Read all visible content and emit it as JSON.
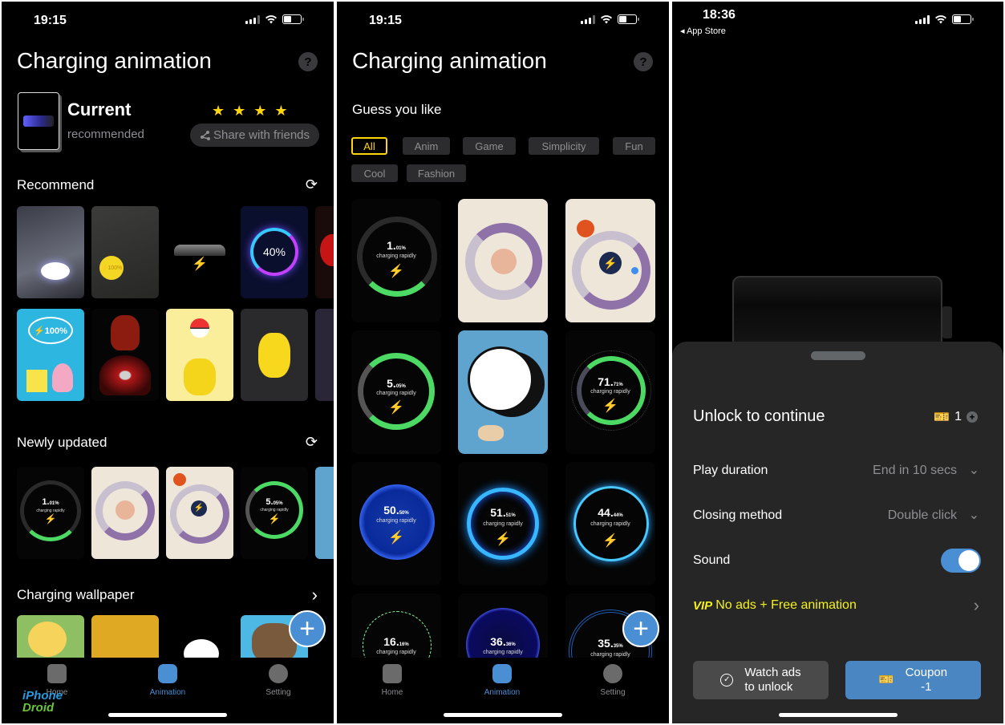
{
  "screens": [
    {
      "status": {
        "time": "19:15"
      },
      "title": "Charging animation",
      "help_glyph": "?",
      "current": {
        "name": "Current",
        "subtitle": "recommended",
        "rating_stars": 4,
        "share_label": "Share with friends"
      },
      "sections": {
        "recommend": {
          "label": "Recommend",
          "icon": "refresh-icon"
        },
        "newly_updated": {
          "label": "Newly updated",
          "icon": "refresh-icon"
        },
        "charging_wallpaper": {
          "label": "Charging wallpaper",
          "icon": "chevron-right-icon"
        }
      },
      "recommend_items": [
        {
          "name": "anime-lightning",
          "text": ""
        },
        {
          "name": "anime-orb",
          "text": "⚡100%"
        },
        {
          "name": "car",
          "text": ""
        },
        {
          "name": "neon-ring",
          "text": "40%"
        },
        {
          "name": "red-logo",
          "text": ""
        },
        {
          "name": "sponge-bubble",
          "text": "⚡100%"
        },
        {
          "name": "iron-hero",
          "text": ""
        },
        {
          "name": "pokeball-pet",
          "text": ""
        },
        {
          "name": "yellow-pet",
          "text": ""
        },
        {
          "name": "partial",
          "text": ""
        }
      ],
      "newly_updated_items": [
        {
          "pct": "1.",
          "small": "01%",
          "sub": "charging rapidly"
        },
        {
          "pct": "",
          "small": "",
          "sub": ""
        },
        {
          "pct": "",
          "small": "",
          "sub": ""
        },
        {
          "pct": "5.",
          "small": "05%",
          "sub": "charging rapidly"
        }
      ],
      "tabs": [
        {
          "label": "Home",
          "active": false
        },
        {
          "label": "Animation",
          "active": true
        },
        {
          "label": "Setting",
          "active": false
        }
      ],
      "fab": "+",
      "watermark": {
        "line1": "iPhone",
        "line2": "Droid"
      }
    },
    {
      "status": {
        "time": "19:15"
      },
      "title": "Charging animation",
      "help_glyph": "?",
      "guess_label": "Guess you like",
      "chips": [
        "All",
        "Anim",
        "Game",
        "Simplicity",
        "Fun",
        "Cool",
        "Fashion"
      ],
      "active_chip": "All",
      "cards": [
        {
          "pct": "1.",
          "small": "01%",
          "sub": "charging rapidly",
          "style": "green-ring"
        },
        {
          "pct": "",
          "small": "",
          "sub": "",
          "style": "purple-pet"
        },
        {
          "pct": "",
          "small": "",
          "sub": "",
          "style": "purple-astronaut"
        },
        {
          "pct": "5.",
          "small": "05%",
          "sub": "charging rapidly",
          "style": "green-ring"
        },
        {
          "pct": "",
          "small": "",
          "sub": "",
          "style": "blue-cartoon"
        },
        {
          "pct": "71.",
          "small": "71%",
          "sub": "charging rapidly",
          "style": "green-dots"
        },
        {
          "pct": "50.",
          "small": "50%",
          "sub": "charging rapidly",
          "style": "blue-orb"
        },
        {
          "pct": "51.",
          "small": "51%",
          "sub": "charging rapidly",
          "style": "blue-ring"
        },
        {
          "pct": "44.",
          "small": "44%",
          "sub": "charging rapidly",
          "style": "blue-electric"
        },
        {
          "pct": "16.",
          "small": "16%",
          "sub": "charging rapidly",
          "style": "wire-globe"
        },
        {
          "pct": "36.",
          "small": "36%",
          "sub": "charging rapidly",
          "style": "blue-orb"
        },
        {
          "pct": "35.",
          "small": "35%",
          "sub": "charging rapidly",
          "style": "tech-ring"
        }
      ],
      "tabs": [
        {
          "label": "Home",
          "active": false
        },
        {
          "label": "Animation",
          "active": true
        },
        {
          "label": "Setting",
          "active": false
        }
      ],
      "fab": "+"
    },
    {
      "status": {
        "time": "18:36",
        "back_label": "◂ App Store"
      },
      "sheet": {
        "title": "Unlock to continue",
        "coupon_count": "1",
        "rows": [
          {
            "label": "Play duration",
            "value": "End in 10 secs"
          },
          {
            "label": "Closing method",
            "value": "Double click"
          },
          {
            "label": "Sound",
            "toggle_on": true
          }
        ],
        "vip_badge": "VIP",
        "vip_label": "No ads + Free animation",
        "watch_ads_line1": "Watch ads",
        "watch_ads_line2": "to unlock",
        "coupon_line1": "Coupon",
        "coupon_line2": "-1"
      }
    }
  ],
  "colors": {
    "accent": "#4a8fd4",
    "chip_active": "#ffd60a",
    "charge_green": "#4cd964",
    "sheet_bg": "#262626",
    "star": "#ffd60a"
  }
}
